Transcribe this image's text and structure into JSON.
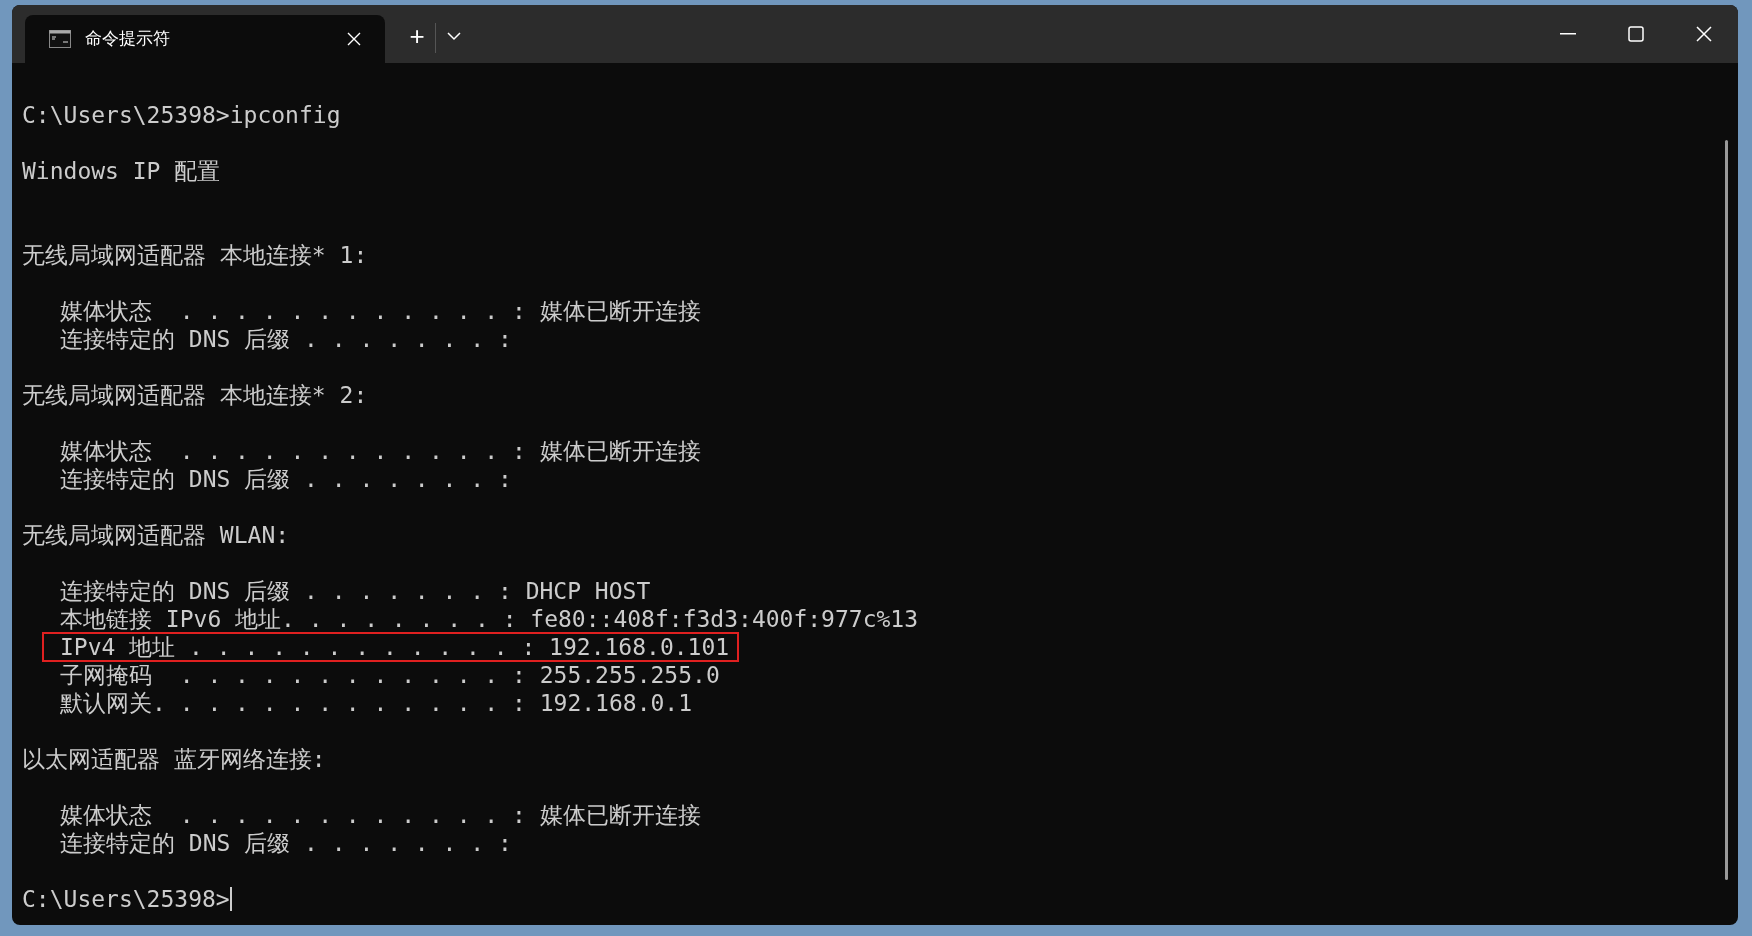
{
  "window": {
    "tabs": [
      {
        "title": "命令提示符",
        "selected": true
      }
    ],
    "new_tab": "+"
  },
  "terminal": {
    "blocks": [
      {
        "kind": "command",
        "lines": [
          {
            "text": "C:\\Users\\25398>ipconfig",
            "highlighted": false
          }
        ]
      },
      {
        "kind": "title",
        "lines": [
          {
            "text": "Windows IP 配置",
            "highlighted": false
          }
        ]
      },
      {
        "kind": "heading",
        "lines": [
          {
            "text": "无线局域网适配器 本地连接* 1:",
            "highlighted": false
          }
        ]
      },
      {
        "kind": "field",
        "lines": [
          {
            "text": "媒体状态  . . . . . . . . . . . . : 媒体已断开连接",
            "highlighted": false
          },
          {
            "text": "连接特定的 DNS 后缀 . . . . . . . :",
            "highlighted": false
          }
        ]
      },
      {
        "kind": "heading",
        "lines": [
          {
            "text": "无线局域网适配器 本地连接* 2:",
            "highlighted": false
          }
        ]
      },
      {
        "kind": "field",
        "lines": [
          {
            "text": "媒体状态  . . . . . . . . . . . . : 媒体已断开连接",
            "highlighted": false
          },
          {
            "text": "连接特定的 DNS 后缀 . . . . . . . :",
            "highlighted": false
          }
        ]
      },
      {
        "kind": "heading",
        "lines": [
          {
            "text": "无线局域网适配器 WLAN:",
            "highlighted": false
          }
        ]
      },
      {
        "kind": "field",
        "lines": [
          {
            "text": "连接特定的 DNS 后缀 . . . . . . . : DHCP HOST",
            "highlighted": false
          },
          {
            "text": "本地链接 IPv6 地址. . . . . . . . : fe80::408f:f3d3:400f:977c%13",
            "highlighted": false
          },
          {
            "text": "IPv4 地址 . . . . . . . . . . . . : 192.168.0.101",
            "highlighted": true
          },
          {
            "text": "子网掩码  . . . . . . . . . . . . : 255.255.255.0",
            "highlighted": false
          },
          {
            "text": "默认网关. . . . . . . . . . . . . : 192.168.0.1",
            "highlighted": false
          }
        ]
      },
      {
        "kind": "heading",
        "lines": [
          {
            "text": "以太网适配器 蓝牙网络连接:",
            "highlighted": false
          }
        ]
      },
      {
        "kind": "field",
        "lines": [
          {
            "text": "媒体状态  . . . . . . . . . . . . : 媒体已断开连接",
            "highlighted": false
          },
          {
            "text": "连接特定的 DNS 后缀 . . . . . . . :",
            "highlighted": false
          }
        ]
      },
      {
        "kind": "prompt",
        "lines": [
          {
            "text": "C:\\Users\\25398>",
            "highlighted": false
          }
        ]
      }
    ]
  }
}
